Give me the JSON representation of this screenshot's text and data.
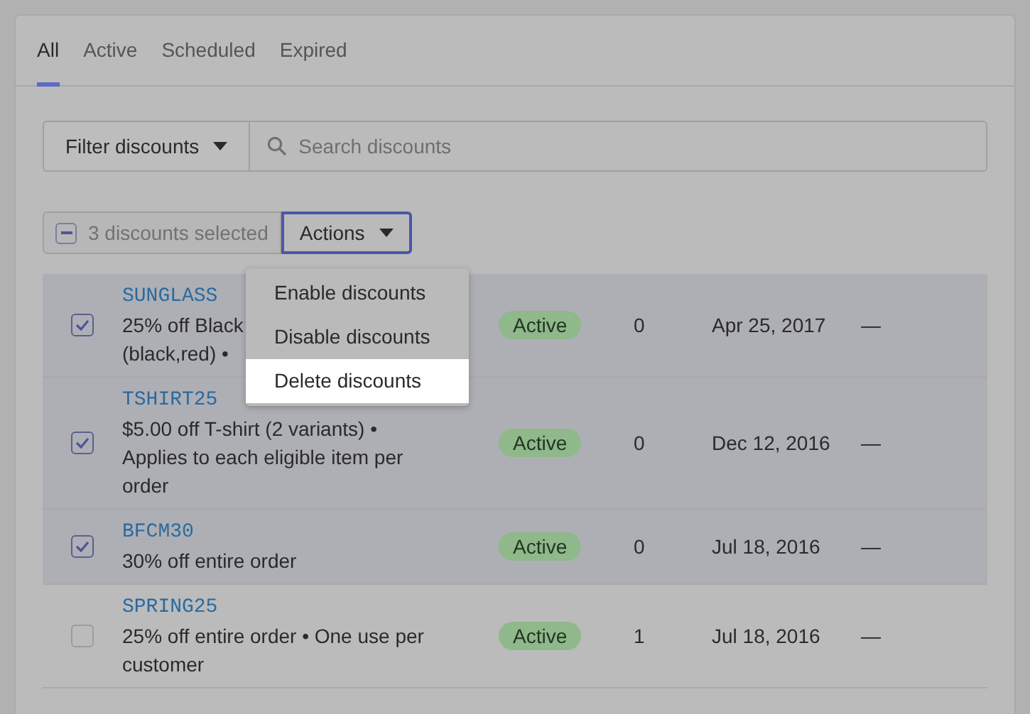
{
  "tabs": [
    {
      "label": "All",
      "selected": true
    },
    {
      "label": "Active",
      "selected": false
    },
    {
      "label": "Scheduled",
      "selected": false
    },
    {
      "label": "Expired",
      "selected": false
    }
  ],
  "filter": {
    "label": "Filter discounts"
  },
  "search": {
    "placeholder": "Search discounts"
  },
  "bulk": {
    "indeterminate": true,
    "label": "3 discounts selected",
    "button": "Actions"
  },
  "menu": [
    {
      "label": "Enable discounts",
      "selected": false
    },
    {
      "label": "Disable discounts",
      "selected": false
    },
    {
      "label": "Delete discounts",
      "selected": true
    }
  ],
  "rows": [
    {
      "code": "SUNGLASS",
      "lines": [
        "25% off Black",
        "(black,red) •"
      ],
      "status": "Active",
      "uses": "0",
      "start": "Apr 25, 2017",
      "end": "—",
      "selected": true
    },
    {
      "code": "TSHIRT25",
      "lines": [
        "$5.00 off T-shirt (2 variants) •",
        "Applies to each eligible item per",
        "order"
      ],
      "status": "Active",
      "uses": "0",
      "start": "Dec 12, 2016",
      "end": "—",
      "selected": true
    },
    {
      "code": "BFCM30",
      "lines": [
        "30% off entire order"
      ],
      "status": "Active",
      "uses": "0",
      "start": "Jul 18, 2016",
      "end": "—",
      "selected": true
    },
    {
      "code": "SPRING25",
      "lines": [
        "25% off entire order • One use per",
        "customer"
      ],
      "status": "Active",
      "uses": "1",
      "start": "Jul 18, 2016",
      "end": "—",
      "selected": false
    }
  ]
}
